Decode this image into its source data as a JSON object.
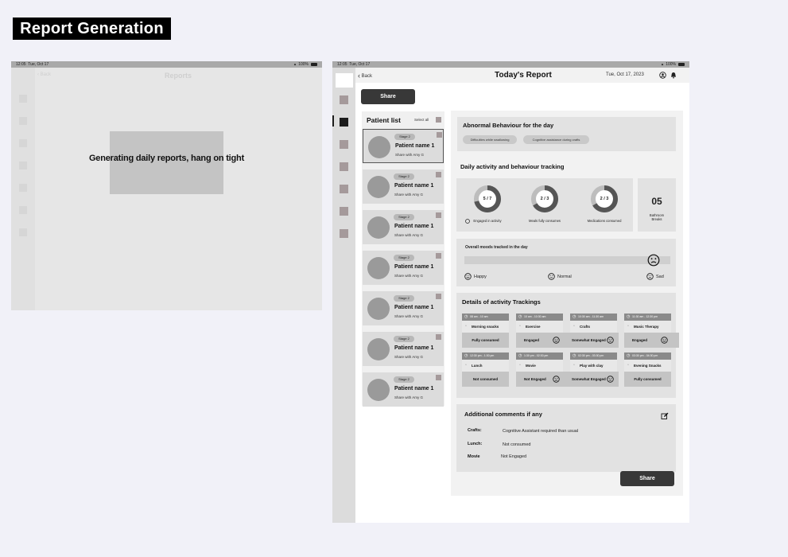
{
  "page_title": "Report Generation",
  "loading_screen": {
    "status": {
      "time": "12:05",
      "date": "Tue, Oct 17",
      "battery": "100%"
    },
    "header_back": "Back",
    "header_title": "Reports",
    "message": "Generating daily reports,  hang on tight"
  },
  "report_screen": {
    "status": {
      "time": "12:05",
      "date": "Tue, Oct 17",
      "battery": "100%"
    },
    "back_label": "Back",
    "title": "Today's Report",
    "date": "Tue, Oct 17, 2023",
    "share_label": "Share",
    "patient_list": {
      "title": "Patient list",
      "select_all": "Select all",
      "patients": [
        {
          "stage": "Stage 2",
          "name": "Patient name 1",
          "share": "Share with Amy G",
          "selected": true
        },
        {
          "stage": "Stage 2",
          "name": "Patient name 1",
          "share": "Share with Amy G",
          "selected": false
        },
        {
          "stage": "Stage 2",
          "name": "Patient name 1",
          "share": "Share with Amy G",
          "selected": false
        },
        {
          "stage": "Stage 2",
          "name": "Patient name 1",
          "share": "Share with Amy G",
          "selected": false
        },
        {
          "stage": "Stage 2",
          "name": "Patient name 1",
          "share": "Share with Amy G",
          "selected": false
        },
        {
          "stage": "Stage 2",
          "name": "Patient name 1",
          "share": "Share with Amy G",
          "selected": false
        },
        {
          "stage": "Stage 2",
          "name": "Patient name 1",
          "share": "Share with Amy G",
          "selected": false
        }
      ]
    },
    "abnormal": {
      "title": "Abnormal Behaviour for the day",
      "chips": [
        "Difficulties while swallowing",
        "Cognitive assistance during crafts"
      ]
    },
    "daily": {
      "title": "Daily activity and behaviour tracking",
      "donuts": [
        {
          "value": "5 / 7",
          "label": "Engaged in activity",
          "fraction": 0.714
        },
        {
          "value": "2 / 3",
          "label": "Meals fully consumes",
          "fraction": 0.667
        },
        {
          "value": "2 / 3",
          "label": "Medications consumed",
          "fraction": 0.667
        }
      ],
      "bathroom": {
        "value": "05",
        "label": "Bathroom Breaks"
      }
    },
    "moods": {
      "title": "Overall moods tracked in the day",
      "level": 0.95,
      "labels": [
        "Happy",
        "Normal",
        "Sad"
      ]
    },
    "details": {
      "title": "Details of activity Trackings",
      "tiles": [
        {
          "time": "08 am - 10 am",
          "activity": "Morning snacks",
          "status": "Fully consumed",
          "face": ""
        },
        {
          "time": "10 am - 10:30 am",
          "activity": "Exercise",
          "status": "Engaged",
          "face": "happy"
        },
        {
          "time": "10:30 am - 11:30 am",
          "activity": "Crafts",
          "status": "Somewhat Engaged",
          "face": "neutral"
        },
        {
          "time": "11:30 am - 12:30 pm",
          "activity": "Music Therapy",
          "status": "Engaged",
          "face": "happy"
        },
        {
          "time": "12:30 pm - 1:30 pm",
          "activity": "Lunch",
          "status": "Not consumed",
          "face": ""
        },
        {
          "time": "1:30 pm - 02:30 pm",
          "activity": "Movie",
          "status": "Not Engaged",
          "face": "sad"
        },
        {
          "time": "02:30 pm - 03:30 pm",
          "activity": "Play with clay",
          "status": "Somewhat Engaged",
          "face": "neutral"
        },
        {
          "time": "03:30 pm - 04:30 pm",
          "activity": "Evening Snacks",
          "status": "Fully consumed",
          "face": ""
        }
      ]
    },
    "comments": {
      "title": "Additional comments if any",
      "items": [
        {
          "label": "Crafts:",
          "value": "Cognitive Assistant required than usual"
        },
        {
          "label": "Lunch:",
          "value": "Not consumed"
        },
        {
          "label": "Movie",
          "value": "Not Engaged"
        }
      ]
    },
    "share_bottom_label": "Share"
  }
}
